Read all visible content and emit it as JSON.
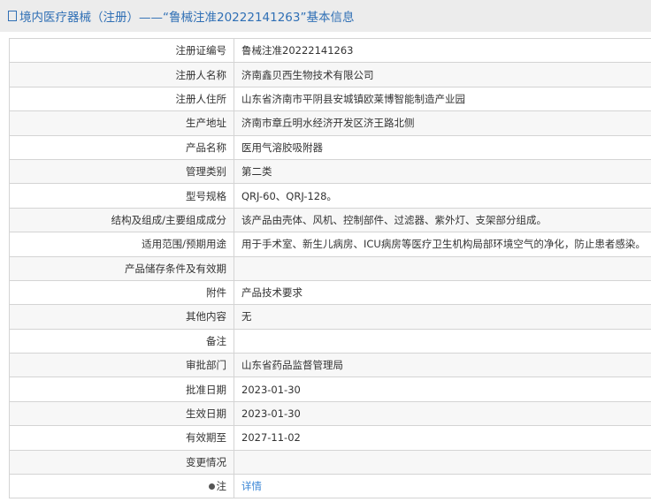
{
  "header": {
    "icon": "document-icon",
    "title": "境内医疗器械（注册）——“鲁械注准20222141263”基本信息"
  },
  "rows": [
    {
      "label": "注册证编号",
      "value": "鲁械注准20222141263"
    },
    {
      "label": "注册人名称",
      "value": "济南鑫贝西生物技术有限公司"
    },
    {
      "label": "注册人住所",
      "value": "山东省济南市平阴县安城镇欧莱博智能制造产业园"
    },
    {
      "label": "生产地址",
      "value": "济南市章丘明水经济开发区济王路北侧"
    },
    {
      "label": "产品名称",
      "value": "医用气溶胶吸附器"
    },
    {
      "label": "管理类别",
      "value": "第二类"
    },
    {
      "label": "型号规格",
      "value": "QRJ-60、QRJ-128。"
    },
    {
      "label": "结构及组成/主要组成成分",
      "value": "该产品由壳体、风机、控制部件、过滤器、紫外灯、支架部分组成。"
    },
    {
      "label": "适用范围/预期用途",
      "value": "用于手术室、新生儿病房、ICU病房等医疗卫生机构局部环境空气的净化，防止患者感染。"
    },
    {
      "label": "产品储存条件及有效期",
      "value": ""
    },
    {
      "label": "附件",
      "value": "产品技术要求"
    },
    {
      "label": "其他内容",
      "value": "无"
    },
    {
      "label": "备注",
      "value": ""
    },
    {
      "label": "审批部门",
      "value": "山东省药品监督管理局"
    },
    {
      "label": "批准日期",
      "value": "2023-01-30"
    },
    {
      "label": "生效日期",
      "value": "2023-01-30"
    },
    {
      "label": "有效期至",
      "value": "2027-11-02"
    },
    {
      "label": "变更情况",
      "value": ""
    }
  ],
  "note": {
    "icon": "pin-icon",
    "label": "注",
    "link": "详情"
  }
}
